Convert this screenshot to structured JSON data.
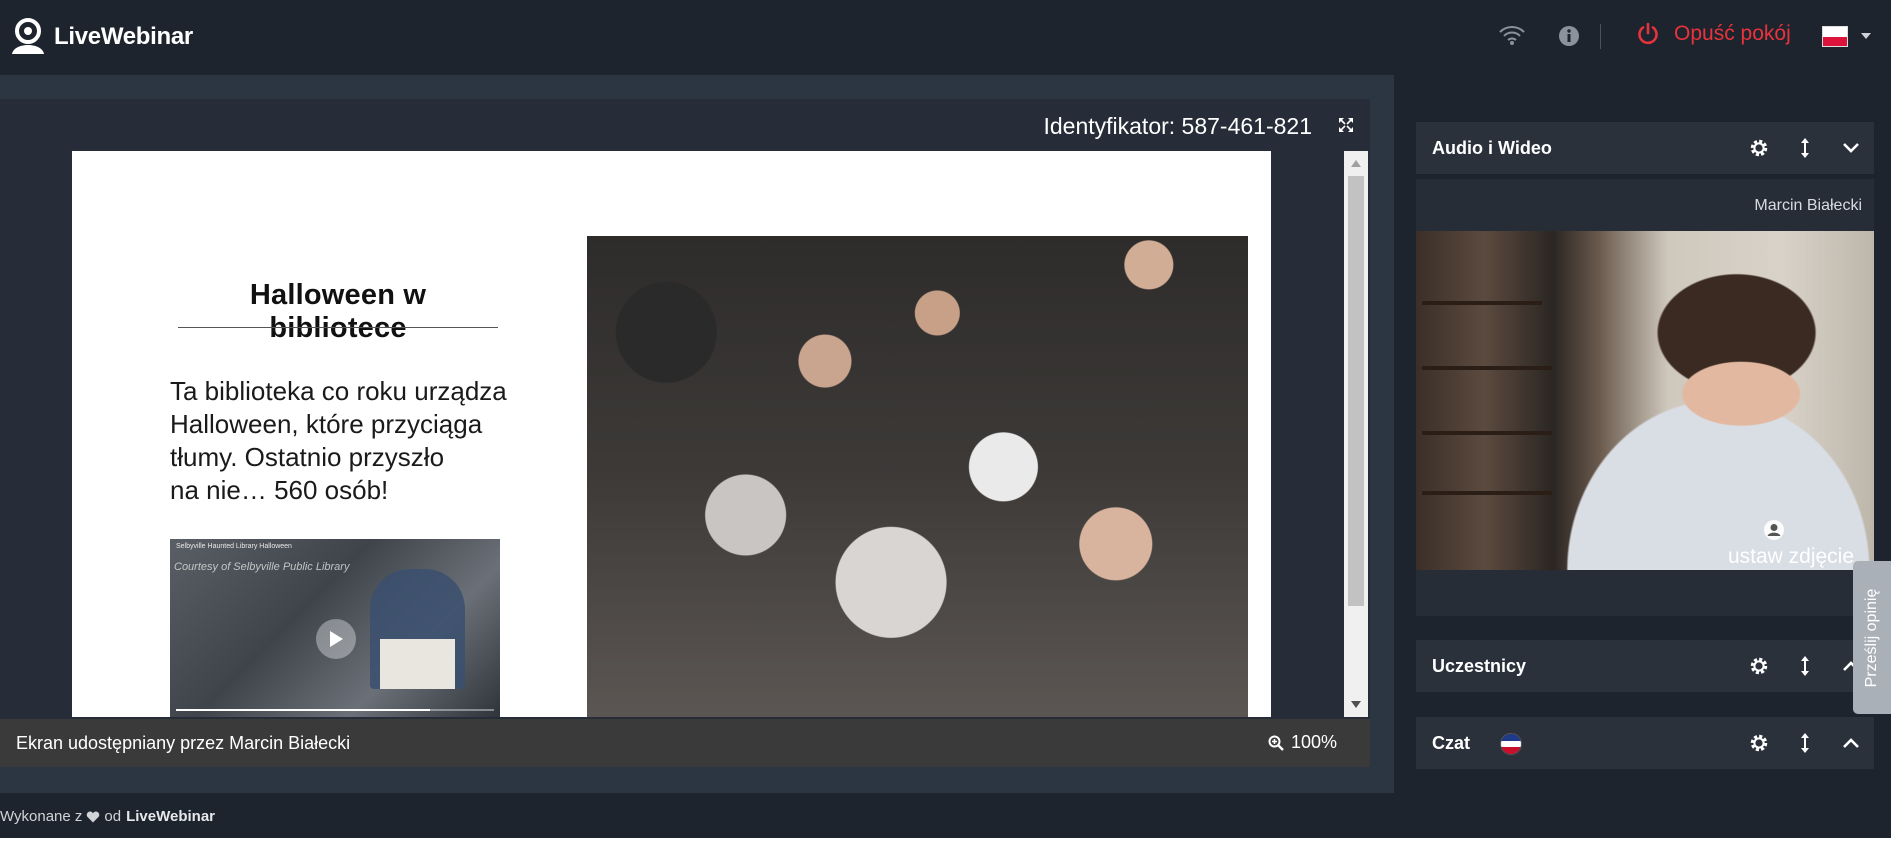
{
  "app": {
    "brand": "LiveWebinar",
    "leave_label": "Opuść pokój",
    "language_flag": "pl"
  },
  "stage": {
    "identifier": "Identyfikator: 587-461-821",
    "shared_by": "Ekran udostępniany przez Marcin Białecki",
    "zoom": "100%"
  },
  "slide": {
    "title": "Halloween w bibliotece",
    "body_lines": [
      "Ta biblioteka co roku urządza",
      "Halloween, które przyciąga",
      "tłumy. Ostatnio przyszło",
      "na nie… 560 osób!"
    ],
    "video_title": "Selbyville Haunted Library Halloween",
    "video_caption": "Courtesy of Selbyville Public Library",
    "video_progress": 0.8
  },
  "sidebar": {
    "audio_video": {
      "title": "Audio i Wideo",
      "participant_name": "Marcin Białecki",
      "set_photo_label": "ustaw zdjęcie"
    },
    "participants": {
      "title": "Uczestnicy"
    },
    "chat": {
      "title": "Czat"
    },
    "feedback_label": "Prześlij opinię"
  },
  "footer": {
    "prefix": "Wykonane z",
    "middle": "od",
    "brand": "LiveWebinar"
  },
  "colors": {
    "accent_red": "#e8333c",
    "bar_bg": "#1e242d",
    "panel_bg": "#2a313b"
  }
}
